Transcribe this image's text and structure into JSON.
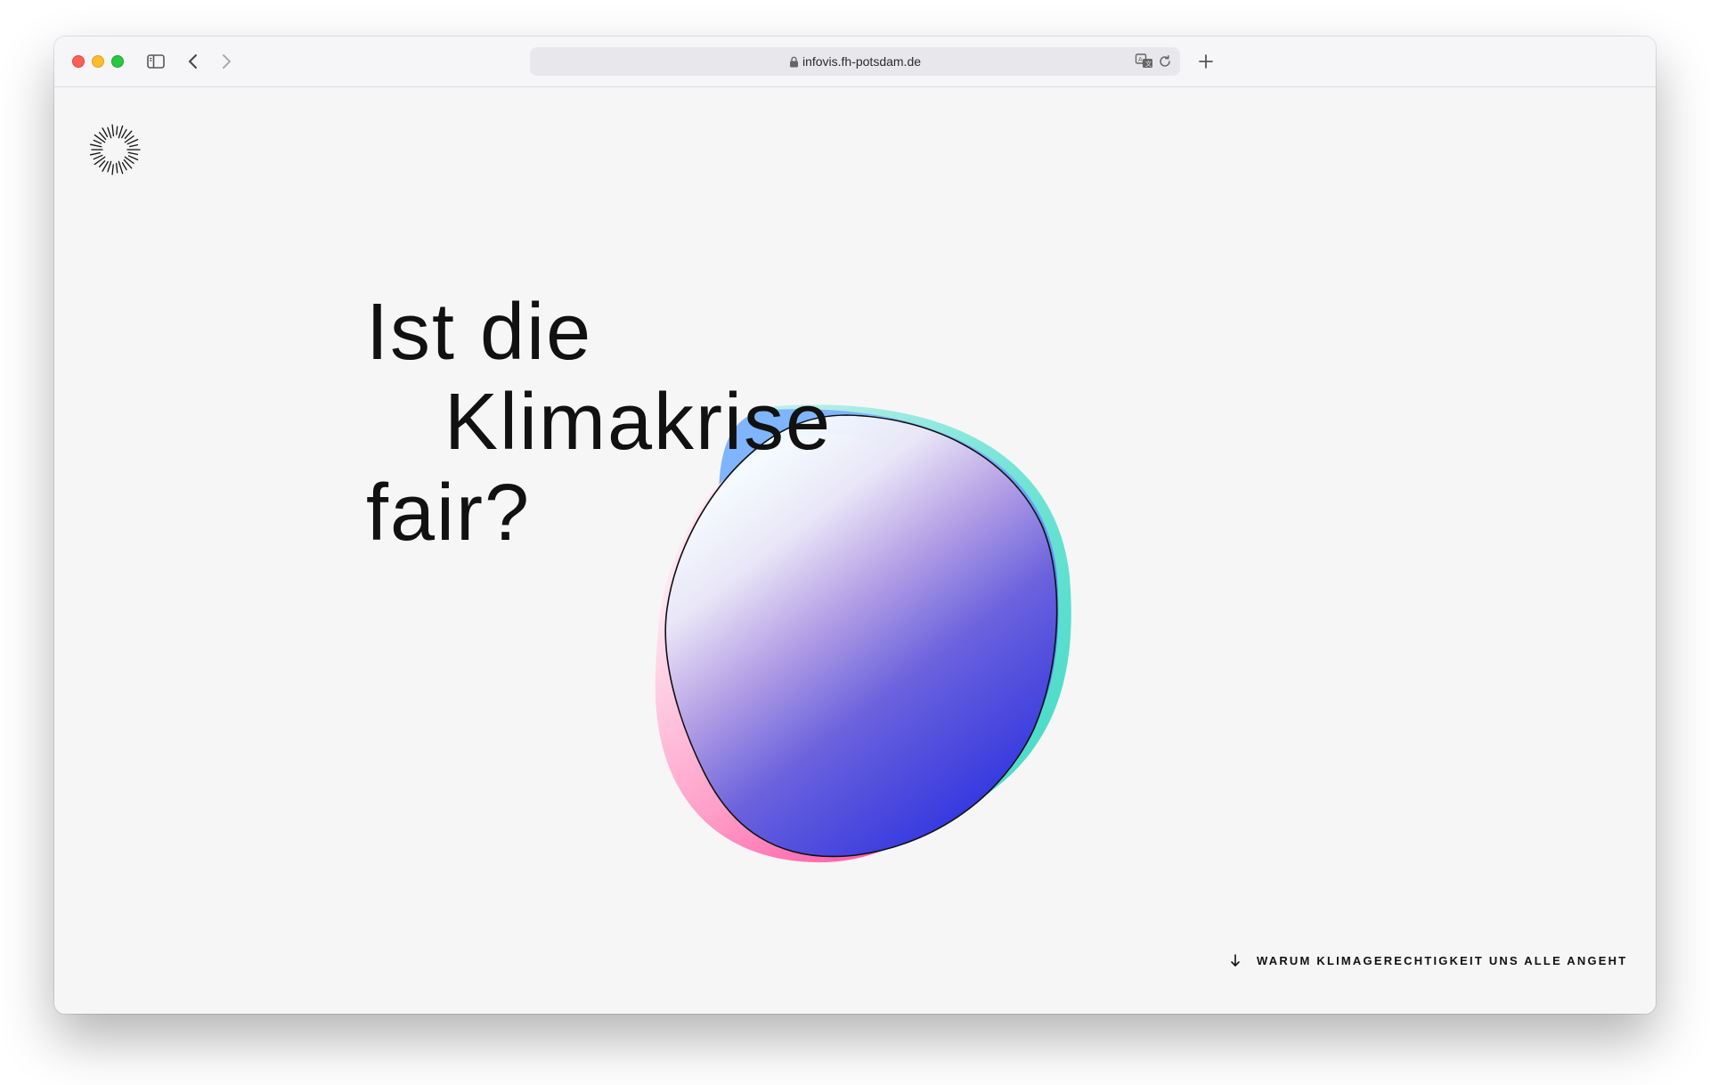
{
  "browser": {
    "url": "infovis.fh-potsdam.de",
    "icons": {
      "close": "close-dot",
      "minimize": "minimize-dot",
      "zoom": "zoom-dot",
      "sidebar": "sidebar-icon",
      "back": "chevron-left-icon",
      "forward": "chevron-right-icon",
      "lock": "lock-icon",
      "translate": "translate-icon",
      "reload": "reload-icon",
      "new_tab": "plus-icon"
    },
    "colors": {
      "close": "#ff5f57",
      "minimize": "#febc2e",
      "zoom": "#28c840"
    }
  },
  "page": {
    "logo_icon": "sunburst-logo-icon",
    "headline": {
      "line1": "Ist die",
      "line2": "Klimakrise",
      "line3": "fair?"
    },
    "scroll_link": {
      "label": "WARUM KLIMAGERECHTIGKEIT UNS ALLE ANGEHT",
      "icon": "arrow-down-icon"
    },
    "colors": {
      "text": "#111111",
      "background": "#f6f6f6",
      "gradient_blue": "#3a3ad8",
      "gradient_pink": "#ff7ab8",
      "gradient_teal": "#5ee6d0"
    }
  }
}
